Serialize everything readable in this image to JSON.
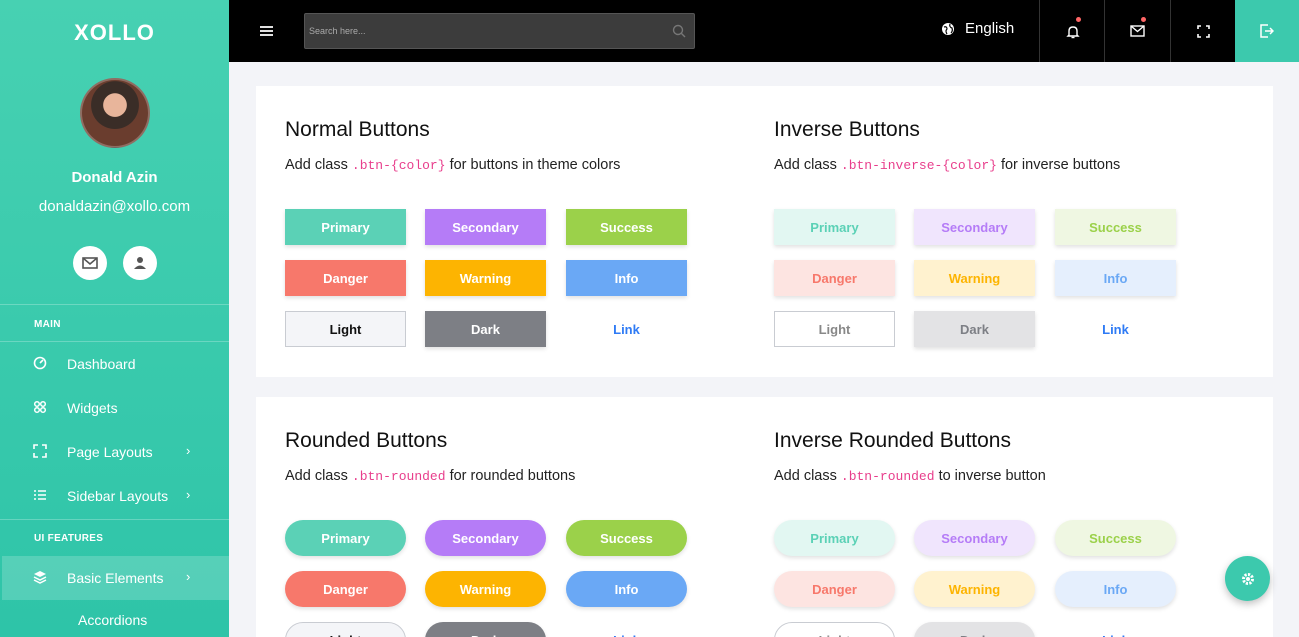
{
  "app": {
    "brand": "XOLLO"
  },
  "user": {
    "name": "Donald Azin",
    "email": "donaldazin@xollo.com"
  },
  "sidebar": {
    "main_heading": "MAIN",
    "ui_heading": "UI FEATURES",
    "items": [
      {
        "label": "Dashboard",
        "icon": "dashboard-icon"
      },
      {
        "label": "Widgets",
        "icon": "widgets-icon"
      },
      {
        "label": "Page Layouts",
        "icon": "page-layouts-icon"
      },
      {
        "label": "Sidebar Layouts",
        "icon": "list-icon"
      },
      {
        "label": "Basic Elements",
        "icon": "layers-icon"
      }
    ],
    "sub_items": [
      "Accordions"
    ]
  },
  "topbar": {
    "search_placeholder": "Search here...",
    "language": "English"
  },
  "colors": {
    "primary": "#5bd1b6",
    "secondary": "#b57cf7",
    "success": "#9bd14a",
    "danger": "#f7786b",
    "warning": "#fdb401",
    "info": "#6aa8f5",
    "light": "#f4f5f8",
    "dark": "#7d7f85",
    "link": "#2f7bf5",
    "accent": "#3cc9ad"
  },
  "cards": {
    "normal": {
      "title": "Normal Buttons",
      "desc_before": "Add class",
      "code": ".btn-{color}",
      "desc_after": "for buttons in theme colors"
    },
    "inverse": {
      "title": "Inverse Buttons",
      "desc_before": "Add class",
      "code": ".btn-inverse-{color}",
      "desc_after": "for inverse buttons"
    },
    "rounded": {
      "title": "Rounded Buttons",
      "desc_before": "Add class",
      "code": ".btn-rounded",
      "desc_after": "for rounded buttons"
    },
    "inverse_rounded": {
      "title": "Inverse Rounded Buttons",
      "desc_before": "Add class",
      "code": ".btn-rounded",
      "desc_after": "to inverse button"
    }
  },
  "buttons": [
    "Primary",
    "Secondary",
    "Success",
    "Danger",
    "Warning",
    "Info",
    "Light",
    "Dark",
    "Link"
  ]
}
